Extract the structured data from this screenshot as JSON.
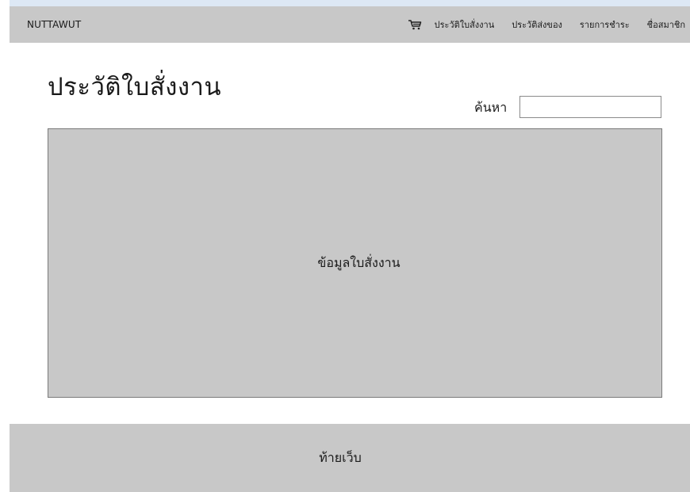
{
  "header": {
    "brand": "NUTTAWUT",
    "cart_icon": "cart-icon",
    "nav": [
      {
        "label": "ประวัติใบสั่งงาน"
      },
      {
        "label": "ประวัติส่งของ"
      },
      {
        "label": "รายการชำระ"
      },
      {
        "label": "ชื่อสมาชิก"
      }
    ]
  },
  "main": {
    "title": "ประวัติใบสั่งงาน",
    "search": {
      "label": "ค้นหา",
      "value": "",
      "placeholder": ""
    },
    "content_placeholder": "ข้อมูลใบสั่งงาน"
  },
  "footer": {
    "text": "ท้ายเว็บ"
  },
  "colors": {
    "panel": "#c8c8c8",
    "border": "#7a7a7a",
    "background": "#ffffff"
  }
}
